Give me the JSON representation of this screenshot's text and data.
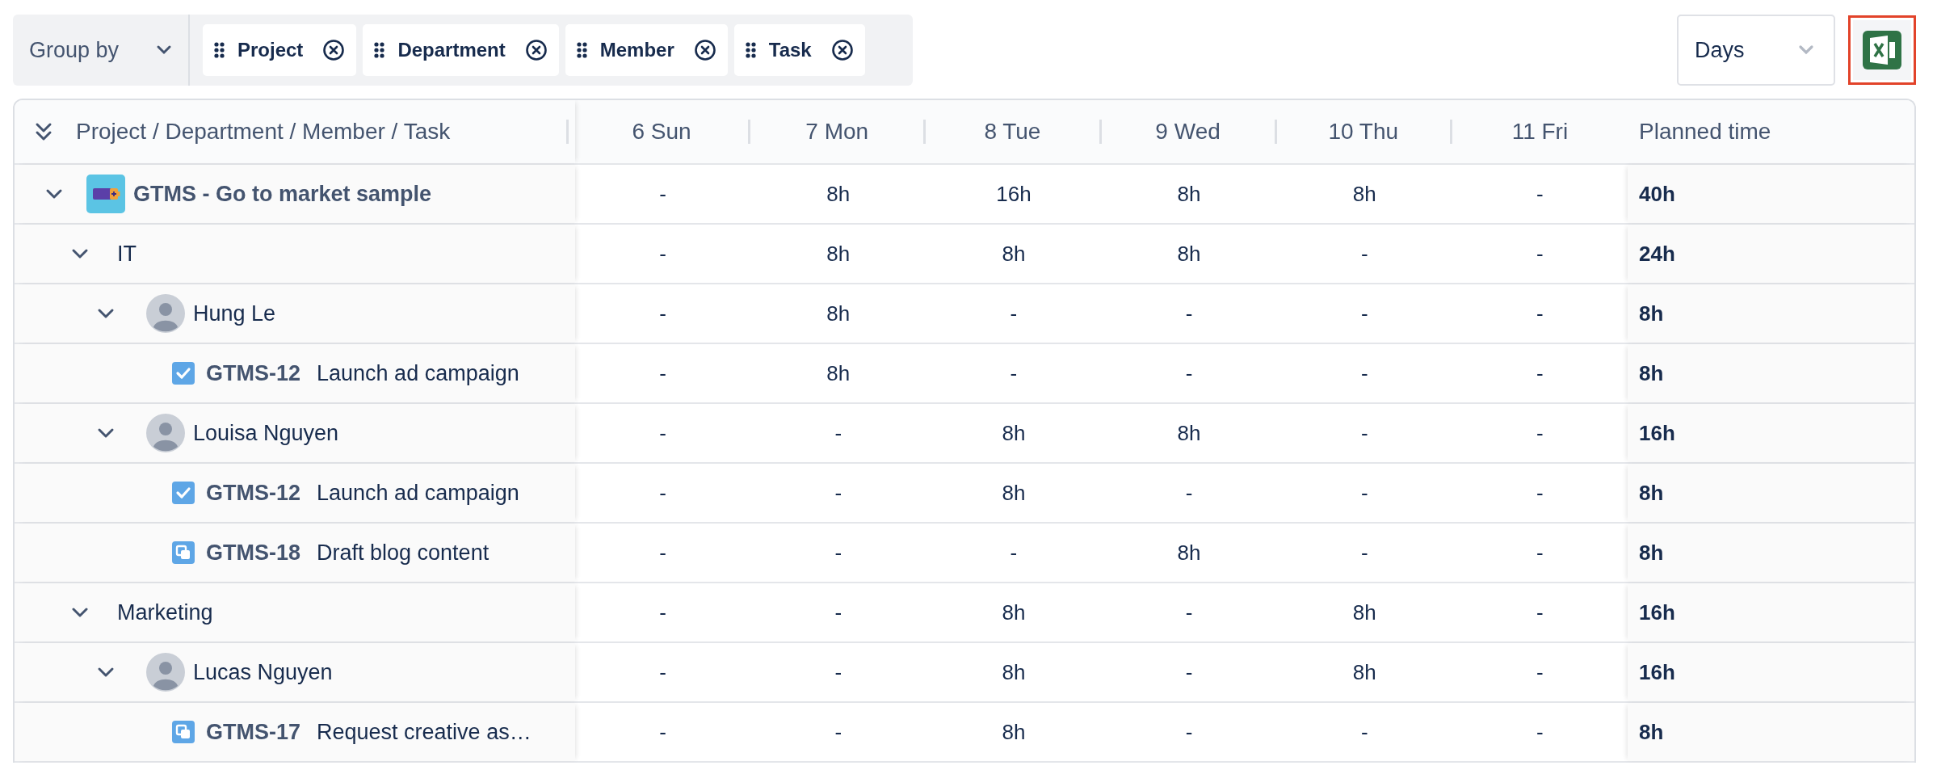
{
  "toolbar": {
    "group_by": {
      "label": "Group by"
    },
    "groups": [
      {
        "label": "Project"
      },
      {
        "label": "Department"
      },
      {
        "label": "Member"
      },
      {
        "label": "Task"
      }
    ],
    "view": {
      "value": "Days"
    },
    "export_button": {
      "highlighted": true
    }
  },
  "table": {
    "tree_header": "Project / Department / Member / Task",
    "columns": [
      "6 Sun",
      "7 Mon",
      "8 Tue",
      "9 Wed",
      "10 Thu",
      "11 Fri"
    ],
    "total_header": "Planned time",
    "rows": [
      {
        "kind": "project",
        "label": "GTMS - Go to market sample",
        "expanded": true,
        "cells": [
          "-",
          "8h",
          "16h",
          "8h",
          "8h",
          "-"
        ],
        "total": "40h",
        "children": [
          {
            "kind": "department",
            "label": "IT",
            "expanded": true,
            "cells": [
              "-",
              "8h",
              "8h",
              "8h",
              "-",
              "-"
            ],
            "total": "24h",
            "children": [
              {
                "kind": "member",
                "label": "Hung Le",
                "expanded": true,
                "cells": [
                  "-",
                  "8h",
                  "-",
                  "-",
                  "-",
                  "-"
                ],
                "total": "8h",
                "children": [
                  {
                    "kind": "task",
                    "icon": {
                      "kind": "check"
                    },
                    "key": "GTMS-12",
                    "label": "Launch ad campaign",
                    "cells": [
                      "-",
                      "8h",
                      "-",
                      "-",
                      "-",
                      "-"
                    ],
                    "total": "8h"
                  }
                ]
              },
              {
                "kind": "member",
                "label": "Louisa Nguyen",
                "expanded": true,
                "cells": [
                  "-",
                  "-",
                  "8h",
                  "8h",
                  "-",
                  "-"
                ],
                "total": "16h",
                "children": [
                  {
                    "kind": "task",
                    "icon": {
                      "kind": "check"
                    },
                    "key": "GTMS-12",
                    "label": "Launch ad campaign",
                    "cells": [
                      "-",
                      "-",
                      "8h",
                      "-",
                      "-",
                      "-"
                    ],
                    "total": "8h"
                  },
                  {
                    "kind": "task",
                    "icon": {
                      "kind": "subtask"
                    },
                    "key": "GTMS-18",
                    "label": "Draft blog content",
                    "cells": [
                      "-",
                      "-",
                      "-",
                      "8h",
                      "-",
                      "-"
                    ],
                    "total": "8h"
                  }
                ]
              }
            ]
          },
          {
            "kind": "department",
            "label": "Marketing",
            "expanded": true,
            "cells": [
              "-",
              "-",
              "8h",
              "-",
              "8h",
              "-"
            ],
            "total": "16h",
            "children": [
              {
                "kind": "member",
                "label": "Lucas Nguyen",
                "expanded": true,
                "cells": [
                  "-",
                  "-",
                  "8h",
                  "-",
                  "8h",
                  "-"
                ],
                "total": "16h",
                "children": [
                  {
                    "kind": "task",
                    "icon": {
                      "kind": "subtask"
                    },
                    "key": "GTMS-17",
                    "label": "Request creative as…",
                    "cells": [
                      "-",
                      "-",
                      "8h",
                      "-",
                      "-",
                      "-"
                    ],
                    "total": "8h"
                  }
                ]
              }
            ]
          }
        ]
      }
    ]
  }
}
